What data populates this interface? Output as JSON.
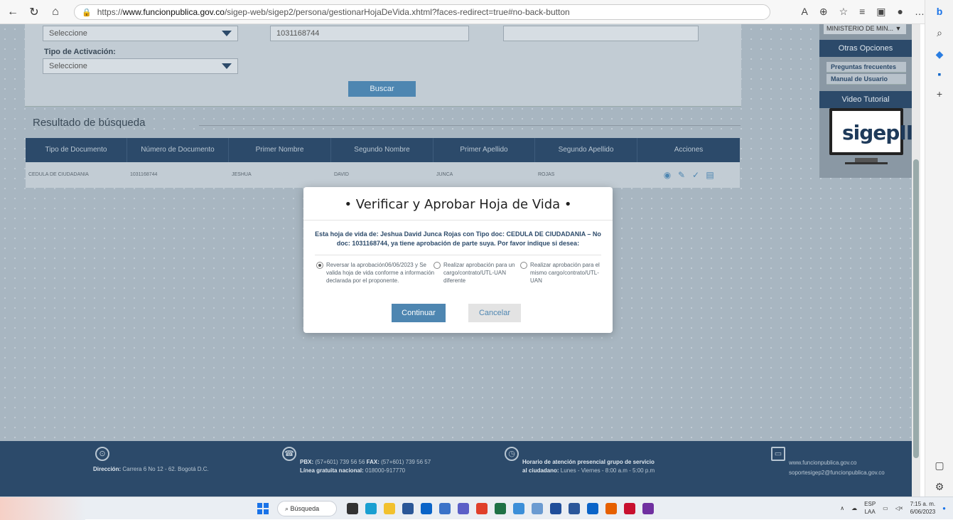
{
  "browser": {
    "url_prefix": "https://",
    "url_host": "www.funcionpublica.gov.co",
    "url_path": "/sigep-web/sigep2/persona/gestionarHojaDeVida.xhtml?faces-redirect=true#no-back-button"
  },
  "search": {
    "select1_value": "Seleccione",
    "doc_input_value": "1031168744",
    "activation_label": "Tipo de Activación:",
    "select2_value": "Seleccione",
    "buscar_label": "Buscar"
  },
  "right_panel": {
    "entity_value": "MINISTERIO DE MIN...",
    "other_options_title": "Otras Opciones",
    "faq_label": "Preguntas frecuentes",
    "manual_label": "Manual de Usuario",
    "video_title": "Video Tutorial",
    "logo_text": "sigepII"
  },
  "results": {
    "title": "Resultado de búsqueda",
    "headers": [
      "Tipo de Documento",
      "Número de Documento",
      "Primer Nombre",
      "Segundo Nombre",
      "Primer Apellido",
      "Segundo Apellido",
      "Acciones"
    ],
    "row": [
      "Cedula de ciudadania",
      "1031168744",
      "JESHUA",
      "DAVID",
      "JUNCA",
      "ROJAS"
    ]
  },
  "modal": {
    "title": "• Verificar y Aprobar Hoja de Vida •",
    "message": "Esta hoja de vida de: Jeshua David Junca Rojas con Tipo doc: CEDULA DE CIUDADANIA – No doc: 1031168744, ya tiene aprobación de parte suya. Por favor indique si desea:",
    "option1": "Reversar la aprobación06/06/2023 y Se valida hoja de vida conforme a información declarada por el proponente.",
    "option2": "Realizar aprobación para un cargo/contrato/UTL-UAN diferente",
    "option3": "Realizar aprobación para el mismo cargo/contrato/UTL-UAN",
    "continue_label": "Continuar",
    "cancel_label": "Cancelar"
  },
  "footer": {
    "address_label": "Dirección:",
    "address_value": "Carrera 6 No 12 - 62. Bogotá D.C.",
    "pbx_label": "PBX:",
    "pbx_value": "(57+601) 739 56 56",
    "fax_label": "FAX:",
    "fax_value": "(57+601) 739 56 57",
    "line_label": "Línea gratuita nacional:",
    "line_value": "018000-917770",
    "hours_label": "Horario de atención presencial grupo de servicio al ciudadano:",
    "hours_value": "Lunes - Viernes - 8:00 a.m - 5:00 p.m",
    "web": "www.funcionpublica.gov.co",
    "email": "soportesigep2@funcionpublica.gov.co"
  },
  "taskbar": {
    "search_label": "Búsqueda",
    "lang": "ESP",
    "lang2": "LAA",
    "time": "7:15 a. m.",
    "date": "6/06/2023"
  }
}
